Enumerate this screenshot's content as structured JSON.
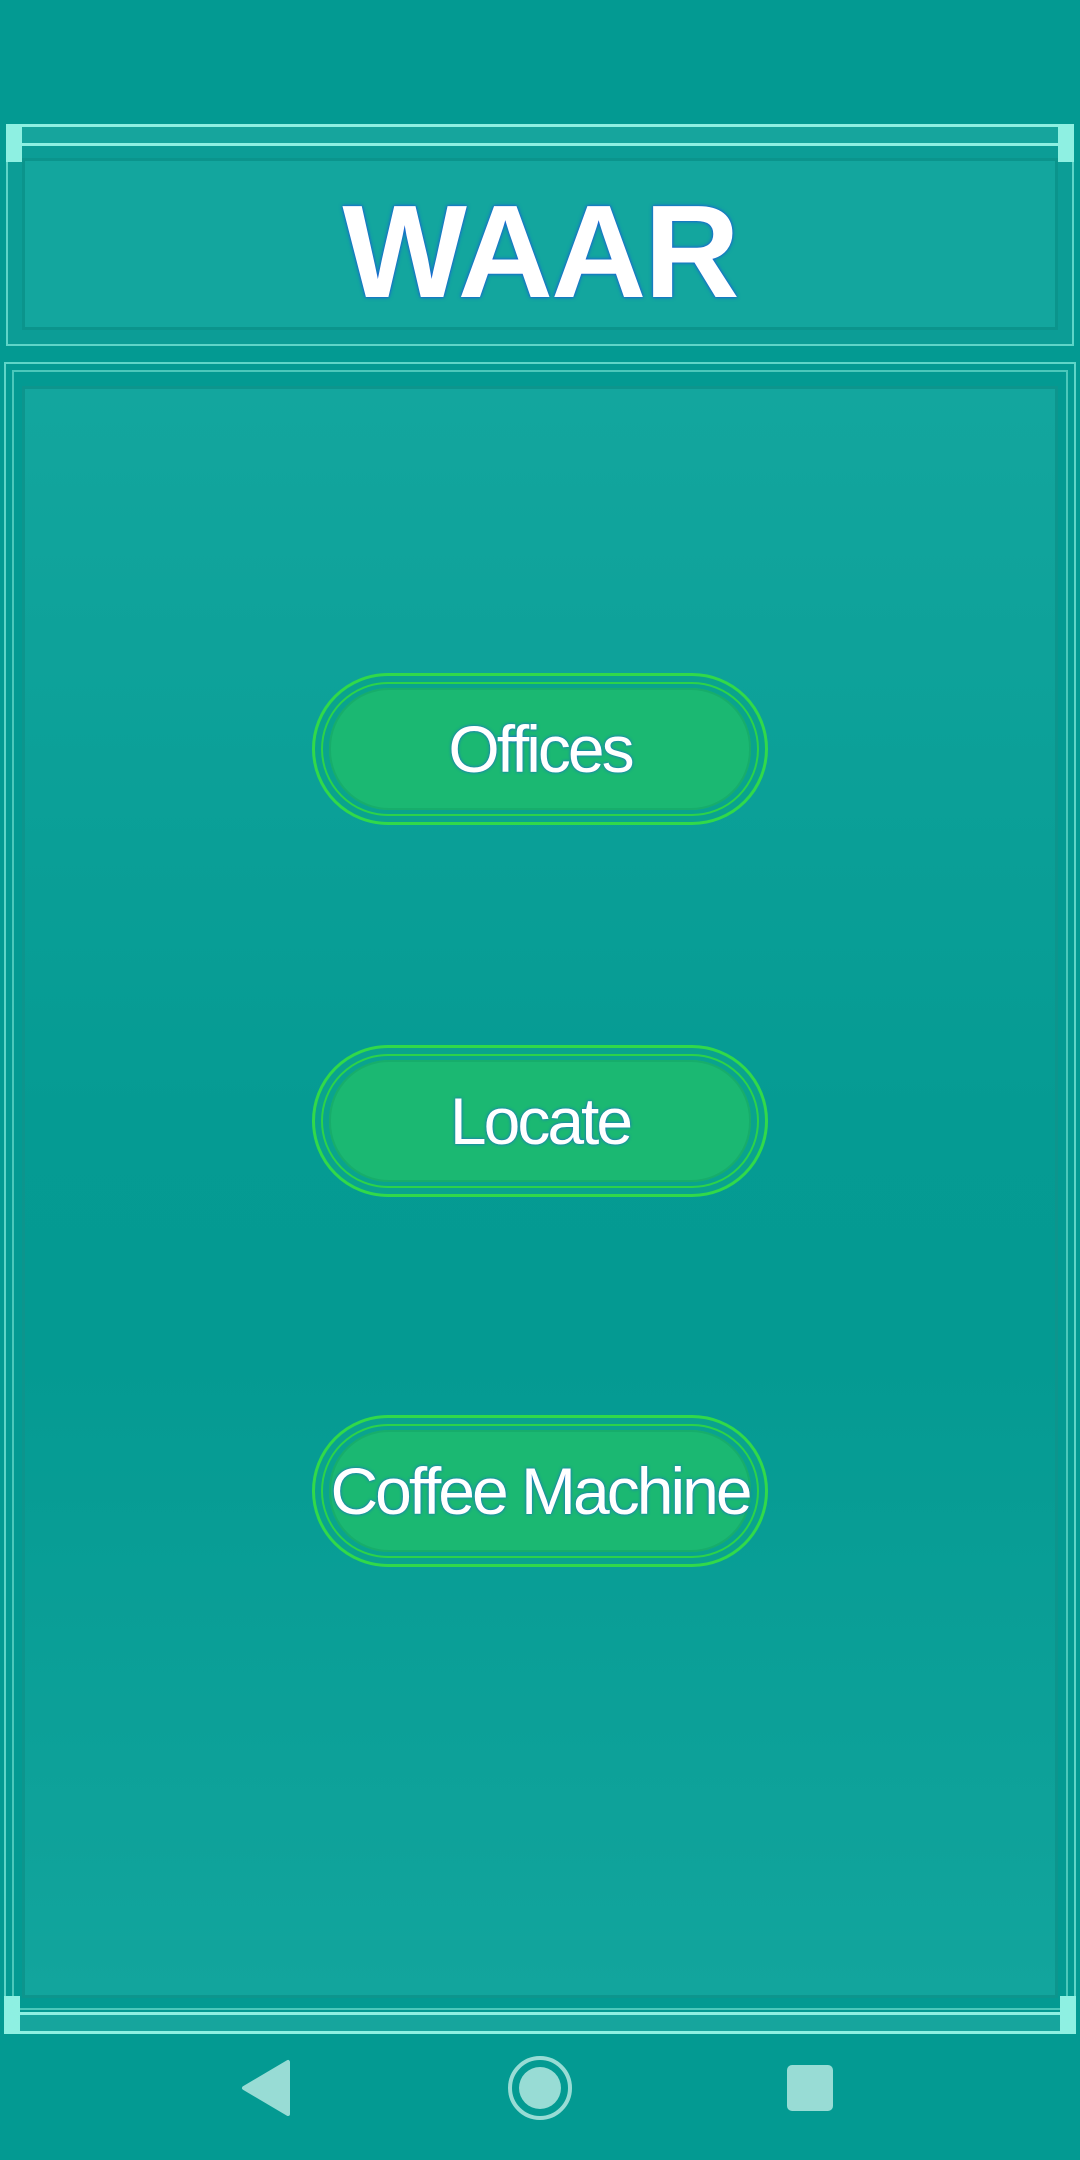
{
  "app": {
    "title": "WAAR"
  },
  "menu": {
    "buttons": [
      {
        "label": "Offices"
      },
      {
        "label": "Locate"
      },
      {
        "label": "Coffee Machine"
      }
    ]
  },
  "nav": {
    "back_icon": "back-triangle-icon",
    "home_icon": "home-circle-icon",
    "recents_icon": "recents-square-icon"
  },
  "colors": {
    "background": "#039a92",
    "frame_accent": "#8ef0e2",
    "button_fill": "#1bb872",
    "button_border": "#31d94a",
    "text": "#ffffff"
  }
}
